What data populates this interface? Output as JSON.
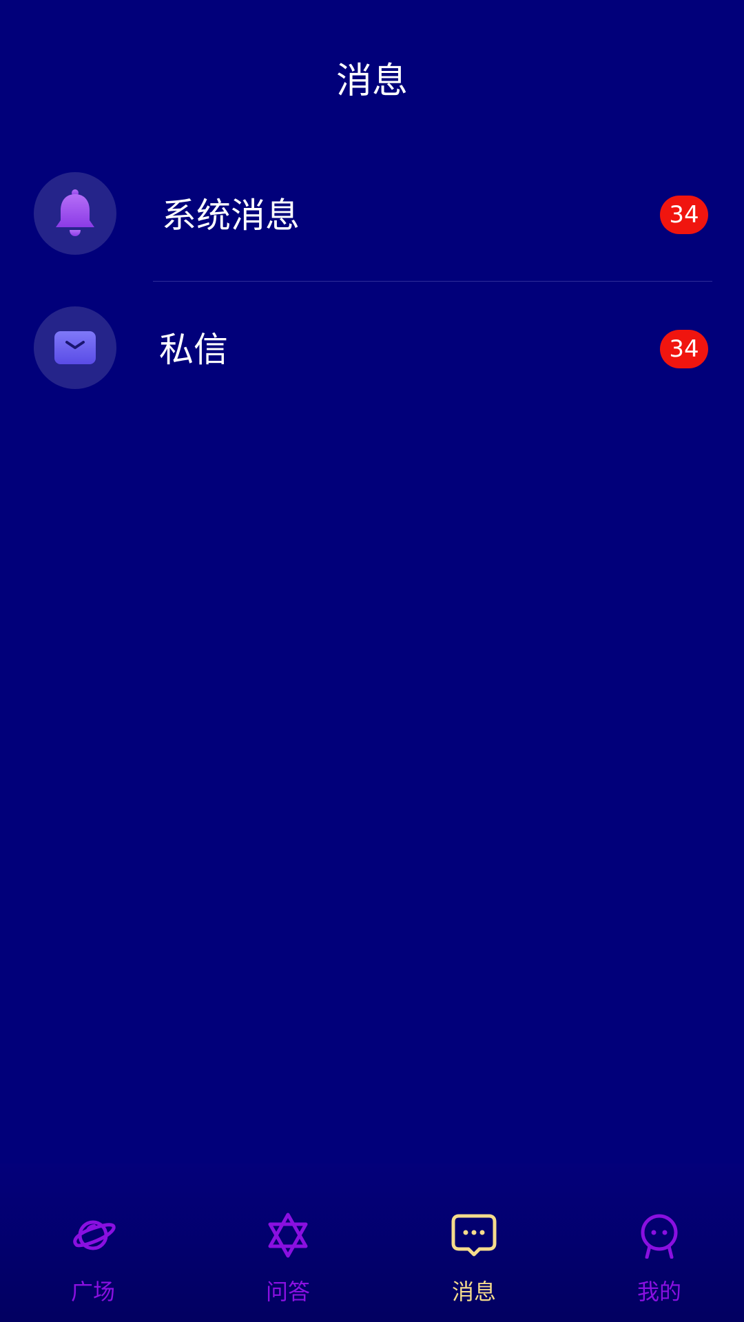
{
  "header": {
    "title": "消息"
  },
  "messages": [
    {
      "label": "系统消息",
      "icon": "bell-icon",
      "badge": "34"
    },
    {
      "label": "私信",
      "icon": "envelope-icon",
      "badge": "34"
    }
  ],
  "tabbar": {
    "tabs": [
      {
        "label": "广场",
        "icon": "planet-icon",
        "active": false
      },
      {
        "label": "问答",
        "icon": "star-of-david-icon",
        "active": false
      },
      {
        "label": "消息",
        "icon": "chat-bubble-icon",
        "active": true
      },
      {
        "label": "我的",
        "icon": "person-icon",
        "active": false
      }
    ],
    "active_color": "#f5dc8c",
    "inactive_color": "#8a10e0"
  },
  "colors": {
    "background": "#01007a",
    "badge": "#f0150f",
    "icon_circle": "#25248a",
    "bell_gradient": [
      "#b46cf6",
      "#8a3ae6"
    ],
    "envelope_gradient": [
      "#7d77f7",
      "#5e4fe8"
    ]
  }
}
